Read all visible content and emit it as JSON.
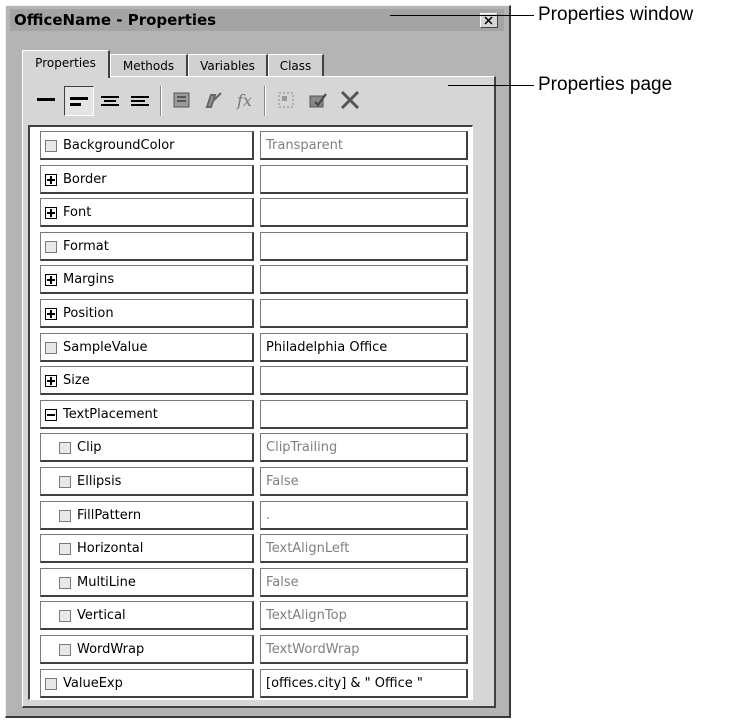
{
  "window": {
    "title": "OfficeName - Properties"
  },
  "tabs": [
    {
      "label": "Properties",
      "active": true
    },
    {
      "label": "Methods",
      "active": false
    },
    {
      "label": "Variables",
      "active": false
    },
    {
      "label": "Class",
      "active": false
    }
  ],
  "toolbar": {
    "buttons": [
      "show-line-icon",
      "align-left-icon",
      "align-center-icon",
      "align-right-icon",
      "properties-icon",
      "edit-icon",
      "function-fx-icon",
      "select-icon",
      "checklist-icon",
      "delete-x-icon"
    ]
  },
  "properties": [
    {
      "name": "BackgroundColor",
      "value": "Transparent",
      "expander": "none",
      "indent": false,
      "value_style": "gray"
    },
    {
      "name": "Border",
      "value": "",
      "expander": "plus",
      "indent": false,
      "value_style": "gray"
    },
    {
      "name": "Font",
      "value": "",
      "expander": "plus",
      "indent": false,
      "value_style": "gray"
    },
    {
      "name": "Format",
      "value": "",
      "expander": "none",
      "indent": false,
      "value_style": "gray"
    },
    {
      "name": "Margins",
      "value": "",
      "expander": "plus",
      "indent": false,
      "value_style": "gray"
    },
    {
      "name": "Position",
      "value": "",
      "expander": "plus",
      "indent": false,
      "value_style": "gray"
    },
    {
      "name": "SampleValue",
      "value": "Philadelphia Office",
      "expander": "none",
      "indent": false,
      "value_style": "dark"
    },
    {
      "name": "Size",
      "value": "",
      "expander": "plus",
      "indent": false,
      "value_style": "gray"
    },
    {
      "name": "TextPlacement",
      "value": "",
      "expander": "minus",
      "indent": false,
      "value_style": "gray"
    },
    {
      "name": "Clip",
      "value": "ClipTrailing",
      "expander": "none",
      "indent": true,
      "value_style": "gray"
    },
    {
      "name": "Ellipsis",
      "value": "False",
      "expander": "none",
      "indent": true,
      "value_style": "gray"
    },
    {
      "name": "FillPattern",
      "value": ".",
      "expander": "none",
      "indent": true,
      "value_style": "gray"
    },
    {
      "name": "Horizontal",
      "value": "TextAlignLeft",
      "expander": "none",
      "indent": true,
      "value_style": "gray"
    },
    {
      "name": "MultiLine",
      "value": "False",
      "expander": "none",
      "indent": true,
      "value_style": "gray"
    },
    {
      "name": "Vertical",
      "value": "TextAlignTop",
      "expander": "none",
      "indent": true,
      "value_style": "gray"
    },
    {
      "name": "WordWrap",
      "value": "TextWordWrap",
      "expander": "none",
      "indent": true,
      "value_style": "gray"
    },
    {
      "name": "ValueExp",
      "value": "[offices.city] & \"  Office \"",
      "expander": "none",
      "indent": false,
      "value_style": "dark"
    }
  ],
  "callouts": [
    {
      "label": "Properties window"
    },
    {
      "label": "Properties page"
    }
  ]
}
